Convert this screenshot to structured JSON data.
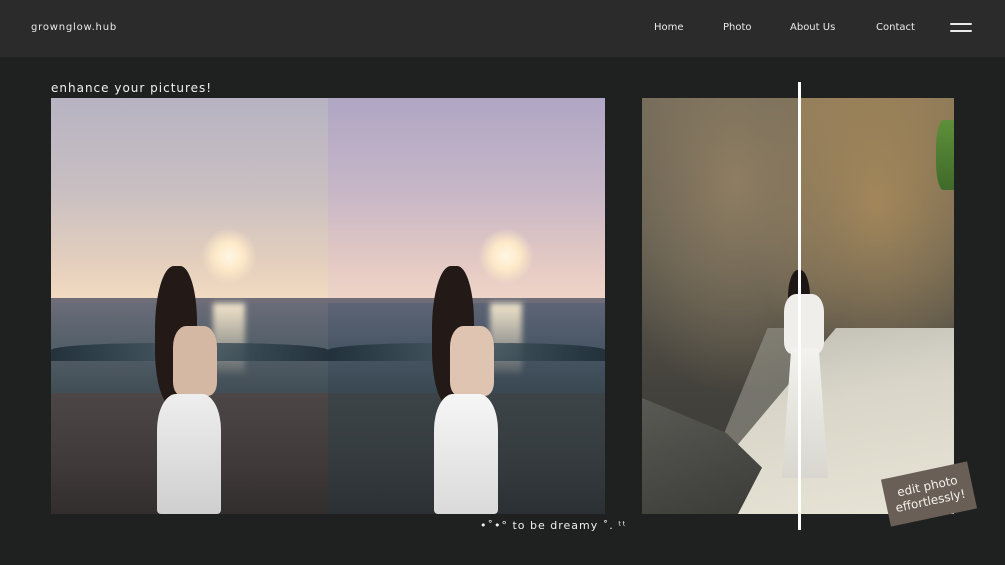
{
  "header": {
    "brand": "growngl​ow.hub",
    "nav": [
      {
        "label": "Home"
      },
      {
        "label": "Photo"
      },
      {
        "label": "About Us"
      },
      {
        "label": "Contact"
      }
    ],
    "menu_icon": "hamburger-menu-icon"
  },
  "main": {
    "tagline": "enhance your pictures!",
    "caption": "•˚•° to be dreamy ˚. ᵗᵗ",
    "sticker": {
      "line1": "edit photo",
      "line2": "effortlessly!"
    }
  },
  "colors": {
    "background": "#1f2120",
    "header": "#2b2b2b",
    "sticker": "#6a5f57",
    "divider": "#ffffff"
  }
}
